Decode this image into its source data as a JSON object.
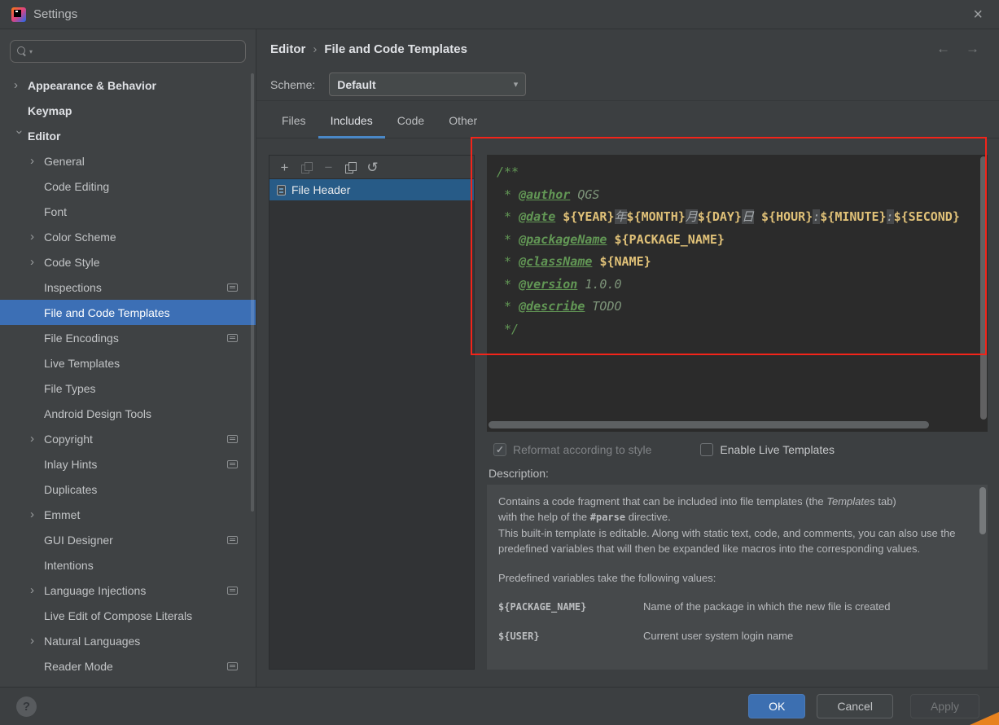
{
  "window": {
    "title": "Settings",
    "close_icon": "×"
  },
  "colors": {
    "accent_selection": "#3c6fb5",
    "list_selection": "#275b87",
    "tab_underline": "#4a88c7",
    "editor_background": "#2b2b2b",
    "annotation_red": "#f3241a",
    "ok_button": "#3c6fb1"
  },
  "header": {
    "breadcrumb": {
      "parent": "Editor",
      "separator": "›",
      "current": "File and Code Templates"
    },
    "back_icon": "←",
    "forward_icon": "→"
  },
  "sidebar": {
    "items": [
      {
        "label": "Appearance & Behavior",
        "level": 0,
        "bold": true,
        "chevron": "collapsed"
      },
      {
        "label": "Keymap",
        "level": 0,
        "bold": true
      },
      {
        "label": "Editor",
        "level": 0,
        "bold": true,
        "chevron": "expanded"
      },
      {
        "label": "General",
        "level": 1,
        "chevron": "collapsed"
      },
      {
        "label": "Code Editing",
        "level": 1
      },
      {
        "label": "Font",
        "level": 1
      },
      {
        "label": "Color Scheme",
        "level": 1,
        "chevron": "collapsed"
      },
      {
        "label": "Code Style",
        "level": 1,
        "chevron": "collapsed"
      },
      {
        "label": "Inspections",
        "level": 1,
        "monitor": true
      },
      {
        "label": "File and Code Templates",
        "level": 1,
        "selected": true
      },
      {
        "label": "File Encodings",
        "level": 1,
        "monitor": true
      },
      {
        "label": "Live Templates",
        "level": 1
      },
      {
        "label": "File Types",
        "level": 1
      },
      {
        "label": "Android Design Tools",
        "level": 1
      },
      {
        "label": "Copyright",
        "level": 1,
        "chevron": "collapsed",
        "monitor": true
      },
      {
        "label": "Inlay Hints",
        "level": 1,
        "monitor": true
      },
      {
        "label": "Duplicates",
        "level": 1
      },
      {
        "label": "Emmet",
        "level": 1,
        "chevron": "collapsed"
      },
      {
        "label": "GUI Designer",
        "level": 1,
        "monitor": true
      },
      {
        "label": "Intentions",
        "level": 1
      },
      {
        "label": "Language Injections",
        "level": 1,
        "chevron": "collapsed",
        "monitor": true
      },
      {
        "label": "Live Edit of Compose Literals",
        "level": 1
      },
      {
        "label": "Natural Languages",
        "level": 1,
        "chevron": "collapsed"
      },
      {
        "label": "Reader Mode",
        "level": 1,
        "monitor": true
      }
    ]
  },
  "scheme": {
    "label": "Scheme:",
    "value": "Default",
    "dropdown_icon": "▾"
  },
  "tabs": [
    {
      "label": "Files"
    },
    {
      "label": "Includes",
      "selected": true
    },
    {
      "label": "Code"
    },
    {
      "label": "Other"
    }
  ],
  "template_panel": {
    "toolbar": [
      {
        "name": "add-template-button",
        "icon": "plus-icon",
        "glyph": "+",
        "enabled": true
      },
      {
        "name": "copy-template-button",
        "icon": "copy-icon",
        "glyph": "",
        "enabled": false
      },
      {
        "name": "remove-template-button",
        "icon": "minus-icon",
        "glyph": "−",
        "enabled": false
      },
      {
        "name": "duplicate-template-button",
        "icon": "duplicate-icon",
        "glyph": "",
        "enabled": true
      },
      {
        "name": "reset-template-button",
        "icon": "reset-icon",
        "glyph": "↺",
        "enabled": true
      }
    ],
    "items": [
      {
        "label": "File Header",
        "selected": true
      }
    ]
  },
  "editor": {
    "lines": [
      [
        {
          "t": "/**",
          "c": "cmt"
        }
      ],
      [
        {
          "t": " * ",
          "c": "cmt"
        },
        {
          "t": "@author",
          "c": "tag"
        },
        {
          "t": " QGS",
          "c": "val"
        }
      ],
      [
        {
          "t": " * ",
          "c": "cmt"
        },
        {
          "t": "@date",
          "c": "tag"
        },
        {
          "t": " ",
          "c": "cmt"
        },
        {
          "t": "${YEAR}",
          "c": "var"
        },
        {
          "t": "年",
          "c": "lit"
        },
        {
          "t": "${MONTH}",
          "c": "var"
        },
        {
          "t": "月",
          "c": "lit"
        },
        {
          "t": "${DAY}",
          "c": "var"
        },
        {
          "t": "日",
          "c": "lit"
        },
        {
          "t": " ",
          "c": "cmt"
        },
        {
          "t": "${HOUR}",
          "c": "var"
        },
        {
          "t": ":",
          "c": "lit"
        },
        {
          "t": "${MINUTE}",
          "c": "var"
        },
        {
          "t": ":",
          "c": "lit"
        },
        {
          "t": "${SECOND}",
          "c": "var"
        }
      ],
      [
        {
          "t": " * ",
          "c": "cmt"
        },
        {
          "t": "@packageName",
          "c": "tag"
        },
        {
          "t": " ",
          "c": "cmt"
        },
        {
          "t": "${PACKAGE_NAME}",
          "c": "var"
        }
      ],
      [
        {
          "t": " * ",
          "c": "cmt"
        },
        {
          "t": "@className",
          "c": "tag"
        },
        {
          "t": " ",
          "c": "cmt"
        },
        {
          "t": "${NAME}",
          "c": "var"
        }
      ],
      [
        {
          "t": " * ",
          "c": "cmt"
        },
        {
          "t": "@version",
          "c": "tag"
        },
        {
          "t": " 1.0.0",
          "c": "val"
        }
      ],
      [
        {
          "t": " * ",
          "c": "cmt"
        },
        {
          "t": "@describe",
          "c": "tag"
        },
        {
          "t": " TODO",
          "c": "val"
        }
      ],
      [
        {
          "t": " */",
          "c": "cmt"
        }
      ]
    ]
  },
  "options": {
    "reformat": {
      "label": "Reformat according to style",
      "checked": true,
      "enabled": false,
      "check_icon": "✓"
    },
    "live_templates": {
      "label": "Enable Live Templates",
      "checked": false
    }
  },
  "description": {
    "label": "Description:",
    "para1": {
      "a": "Contains a code fragment that can be included into file templates (the ",
      "b": "Templates",
      "c": " tab)",
      "d": "with the help of the ",
      "e": "#parse",
      "f": " directive."
    },
    "para2": "This built-in template is editable. Along with static text, code, and comments, you can also use the predefined variables that will then be expanded like macros into the corresponding values.",
    "para3": "Predefined variables take the following values:",
    "variables": [
      {
        "name": "${PACKAGE_NAME}",
        "desc": "Name of the package in which the new file is created"
      },
      {
        "name": "${USER}",
        "desc": "Current user system login name"
      }
    ]
  },
  "footer": {
    "help_icon": "?",
    "ok": "OK",
    "cancel": "Cancel",
    "apply": "Apply"
  }
}
